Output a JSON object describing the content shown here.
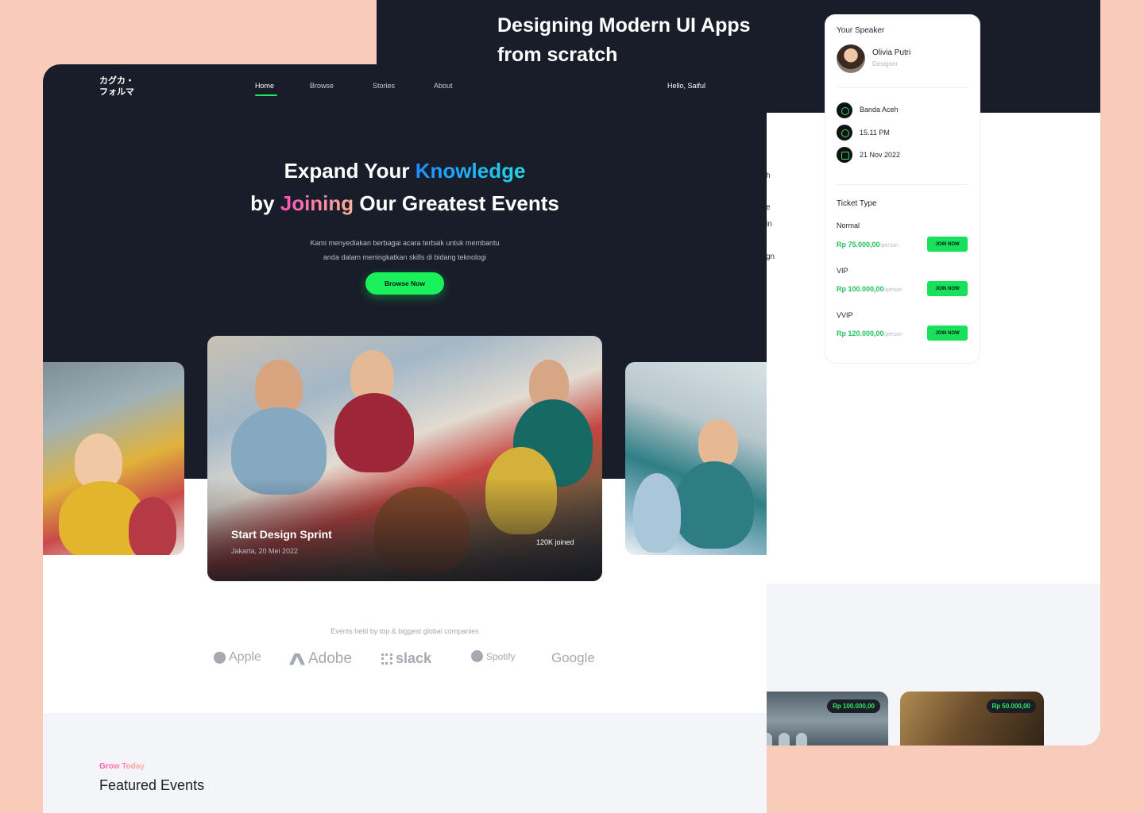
{
  "detail": {
    "title_line1": "Designing Modern UI Apps",
    "title_line2": "from scratch",
    "speaker_label": "Your Speaker",
    "speaker_name": "Olivia Putri",
    "speaker_role": "Designer",
    "location": "Banda Aceh",
    "time": "15.11 PM",
    "date": "21 Nov 2022",
    "ticket_type_label": "Ticket Type",
    "tickets": [
      {
        "tier": "Normal",
        "price": "Rp 75.000,00",
        "per": "/person",
        "button": "JOIN NOW"
      },
      {
        "tier": "VIP",
        "price": "Rp 100.000,00",
        "per": "/person",
        "button": "JOIN NOW"
      },
      {
        "tier": "VVIP",
        "price": "Rp 120.000,00",
        "per": "/person",
        "button": "JOIN NOW"
      }
    ],
    "fragments": [
      "h",
      "e",
      "in",
      "gn"
    ],
    "event_cards": [
      {
        "price": "Rp 100.000,00"
      },
      {
        "price": "Rp 50.000,00"
      }
    ]
  },
  "landing": {
    "logo_line1": "カグカ・",
    "logo_line2": "フォルマ",
    "nav": [
      "Home",
      "Browse",
      "Stories",
      "About"
    ],
    "greeting": "Hello, Saiful",
    "headline": {
      "p1": "Expand Your ",
      "p2": "Knowledge",
      "p3": "by ",
      "p4": "Joining",
      "p5": " Our Greatest Events"
    },
    "subtext_line1": "Kami menyediakan berbagai acara terbaik untuk membantu",
    "subtext_line2": "anda dalam meningkatkan skills di bidang teknologi",
    "cta": "Browse Now",
    "featured_event": {
      "title": "Start Design Sprint",
      "location_date": "Jakarta, 20 Mei 2022",
      "joined": "120K joined"
    },
    "held_by": "Events held by top & biggest global companies",
    "brands": [
      "Apple",
      "Adobe",
      "slack",
      "Spotify",
      "Google"
    ],
    "section_kicker": "Grow Today",
    "section_title": "Featured Events"
  },
  "colors": {
    "background": "#f8cbbb",
    "dark": "#181d29",
    "accent_green": "#19f05c",
    "accent_blue": "#1c8fff",
    "accent_pink": "#ff4fb7"
  }
}
